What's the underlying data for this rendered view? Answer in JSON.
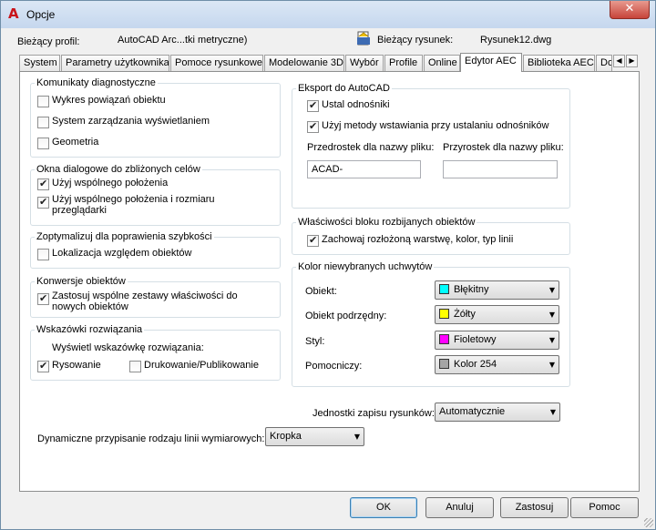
{
  "window": {
    "title": "Opcje",
    "close_glyph": "✕",
    "app_logo": "A"
  },
  "header": {
    "profile_label": "Bieżący profil:",
    "profile_value": "AutoCAD Arc...tki metryczne)",
    "drawing_label": "Bieżący rysunek:",
    "drawing_value": "Rysunek12.dwg",
    "drawing_icon": "drawing-file-icon"
  },
  "tabs": [
    "System",
    "Parametry użytkownika",
    "Pomoce rysunkowe",
    "Modelowanie 3D",
    "Wybór",
    "Profile",
    "Online",
    "Edytor AEC",
    "Biblioteka AEC",
    "Do"
  ],
  "active_tab": "Edytor AEC",
  "tab_scroll": {
    "left": "◀",
    "right": "▶"
  },
  "left": {
    "diagnostics": {
      "title": "Komunikaty diagnostyczne",
      "items": [
        {
          "label": "Wykres powiązań obiektu",
          "checked": false
        },
        {
          "label": "System zarządzania wyświetlaniem",
          "checked": false
        },
        {
          "label": "Geometria",
          "checked": false
        }
      ]
    },
    "dialogs": {
      "title": "Okna dialogowe do zbliżonych celów",
      "items": [
        {
          "label": "Użyj wspólnego położenia",
          "checked": true
        },
        {
          "label": "Użyj wspólnego położenia i rozmiaru przeglądarki",
          "checked": true
        }
      ]
    },
    "optimize": {
      "title": "Zoptymalizuj dla poprawienia szybkości",
      "items": [
        {
          "label": "Lokalizacja względem obiektów",
          "checked": false
        }
      ]
    },
    "conversion": {
      "title": "Konwersje obiektów",
      "items": [
        {
          "label": "Zastosuj wspólne zestawy właściwości do nowych obiektów",
          "checked": true
        }
      ]
    },
    "hints": {
      "title": "Wskazówki rozwiązania",
      "sub_label": "Wyświetl wskazówkę rozwiązania:",
      "items": [
        {
          "label": "Rysowanie",
          "checked": true
        },
        {
          "label": "Drukowanie/Publikowanie",
          "checked": false
        }
      ]
    },
    "dimension_label": "Dynamiczne przypisanie rodzaju linii wymiarowych:",
    "dimension_value": "Kropka"
  },
  "right": {
    "export": {
      "title": "Eksport do AutoCAD",
      "items": [
        {
          "label": "Ustal odnośniki",
          "checked": true
        },
        {
          "label": "Użyj metody wstawiania przy ustalaniu odnośników",
          "checked": true
        }
      ],
      "prefix_label": "Przedrostek dla nazwy pliku:",
      "prefix_value": "ACAD-",
      "suffix_label": "Przyrostek dla nazwy pliku:",
      "suffix_value": ""
    },
    "block": {
      "title": "Właściwości bloku rozbijanych obiektów",
      "items": [
        {
          "label": "Zachowaj rozłożoną warstwę, kolor, typ linii",
          "checked": true
        }
      ]
    },
    "grips": {
      "title": "Kolor niewybranych uchwytów",
      "rows": [
        {
          "label": "Obiekt:",
          "value": "Błękitny",
          "color": "#00ffff"
        },
        {
          "label": "Obiekt podrzędny:",
          "value": "Żółty",
          "color": "#ffff00"
        },
        {
          "label": "Styl:",
          "value": "Fioletowy",
          "color": "#ff00ff"
        },
        {
          "label": "Pomocniczy:",
          "value": "Kolor 254",
          "color": "#a5a5a5"
        }
      ]
    },
    "units_label": "Jednostki zapisu rysunków:",
    "units_value": "Automatycznie"
  },
  "footer": {
    "ok": "OK",
    "cancel": "Anuluj",
    "apply": "Zastosuj",
    "help": "Pomoc"
  },
  "dropdown_arrow": "▼"
}
